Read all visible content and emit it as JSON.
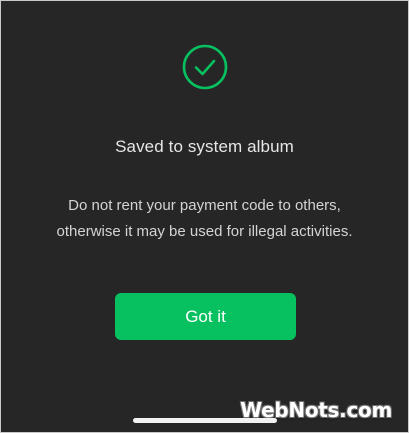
{
  "dialog": {
    "icon": "check-circle-icon",
    "title": "Saved to system album",
    "message_line1": "Do not rent your payment code to others,",
    "message_line2": "otherwise it may be used for illegal activities.",
    "button_label": "Got it"
  },
  "watermark": "WebNots.com",
  "colors": {
    "background": "#262626",
    "accent": "#07c160",
    "title_text": "#e6e6e6",
    "body_text": "#d4d4d4"
  }
}
